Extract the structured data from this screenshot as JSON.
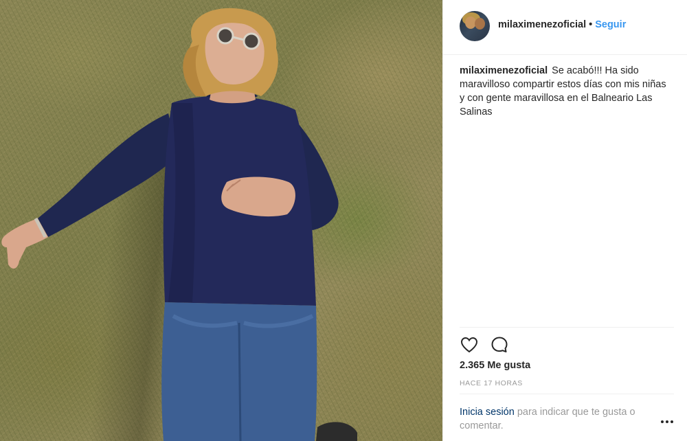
{
  "post": {
    "author": {
      "username": "milaximenezoficial",
      "separator": "•",
      "follow_label": "Seguir"
    },
    "caption": {
      "username": "milaximenezoficial",
      "text": "Se acabó!!! Ha sido maravilloso compartir estos días con mis niñas y con gente maravillosa en el Balneario Las Salinas"
    },
    "actions": {
      "like_icon": "heart-icon",
      "comment_icon": "comment-icon"
    },
    "likes_text": "2.365 Me gusta",
    "timestamp": "HACE 17 HORAS",
    "login_prompt": {
      "link_text": "Inicia sesión",
      "rest_text": " para indicar que te gusta o comentar."
    },
    "more_icon": "more-options-icon"
  },
  "colors": {
    "link_blue": "#3897f0",
    "text_primary": "#262626",
    "text_secondary": "#999999",
    "login_link": "#003569",
    "divider": "#efefef"
  }
}
